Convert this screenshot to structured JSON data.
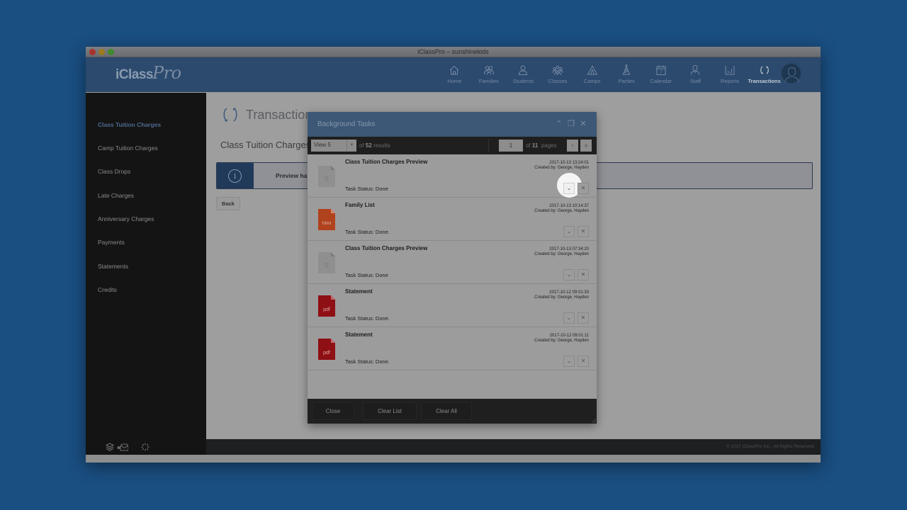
{
  "window": {
    "title": "iClassPro – sunshinekids"
  },
  "brand": {
    "logo_main": "iClass",
    "logo_script": "Pro"
  },
  "topnav": {
    "items": [
      {
        "label": "Home",
        "icon": "home-icon"
      },
      {
        "label": "Families",
        "icon": "families-icon"
      },
      {
        "label": "Students",
        "icon": "student-icon"
      },
      {
        "label": "Classes",
        "icon": "classes-icon"
      },
      {
        "label": "Camps",
        "icon": "tent-icon"
      },
      {
        "label": "Parties",
        "icon": "party-hat-icon"
      },
      {
        "label": "Calendar",
        "icon": "calendar-icon"
      },
      {
        "label": "Staff",
        "icon": "staff-icon"
      },
      {
        "label": "Reports",
        "icon": "bar-chart-icon"
      },
      {
        "label": "Transactions",
        "icon": "refresh-icon",
        "active": true
      }
    ],
    "calendar_day": "7"
  },
  "sidebar": {
    "items": [
      {
        "label": "Class Tuition Charges",
        "active": true
      },
      {
        "label": "Camp Tuition Charges"
      },
      {
        "label": "Class Drops"
      },
      {
        "label": "Late Charges"
      },
      {
        "label": "Anniversary Charges"
      },
      {
        "label": "Payments"
      },
      {
        "label": "Statements"
      },
      {
        "label": "Credits"
      }
    ]
  },
  "main": {
    "page_title": "Transactions",
    "sub_title": "Class Tuition Charges",
    "info_text": "Preview has",
    "info_icon": "i",
    "back_label": "Back"
  },
  "dialog": {
    "title": "Background Tasks",
    "view_select": "View 5",
    "results_prefix": "of",
    "results_count": "52",
    "results_suffix": "results",
    "page_current": "1",
    "pages_prefix": "of",
    "pages_total": "11",
    "pages_suffix": "pages",
    "next_label": "›",
    "last_label": "»",
    "tasks": [
      {
        "name": "Class Tuition Charges Preview",
        "date": "2017-10-13 13:24:01",
        "created_by": "Created by: George, Hayden",
        "status": "Task Status: Done",
        "file_type": "preview",
        "file_label": "Q"
      },
      {
        "name": "Family List",
        "date": "2017-10-13 10:14:37",
        "created_by": "Created by: George, Hayden",
        "status": "Task Status: Done.",
        "file_type": "html",
        "file_label": "html"
      },
      {
        "name": "Class Tuition Charges Preview",
        "date": "2017-10-13 07:34:20",
        "created_by": "Created by: George, Hayden",
        "status": "Task Status: Done",
        "file_type": "preview",
        "file_label": "Q"
      },
      {
        "name": "Statement",
        "date": "2017-10-12 09:01:33",
        "created_by": "Created by: George, Hayden",
        "status": "Task Status: Done.",
        "file_type": "pdf",
        "file_label": "pdf"
      },
      {
        "name": "Statement",
        "date": "2017-10-12 09:01:11",
        "created_by": "Created by: George, Hayden",
        "status": "Task Status: Done.",
        "file_type": "pdf",
        "file_label": "pdf"
      }
    ],
    "footer_buttons": {
      "close": "Close",
      "clear_list": "Clear List",
      "clear_all": "Clear All"
    }
  },
  "footer": {
    "copyright": "© 2017 iClassPro Inc., All Rights Reserved."
  },
  "colors": {
    "desktop": "#1a4f82",
    "nav_bg": "#2c4a6d",
    "dialog_header": "#3d5876",
    "html_file": "#b0421e",
    "pdf_file": "#8e0f14",
    "preview_file": "#8f8f8f"
  }
}
